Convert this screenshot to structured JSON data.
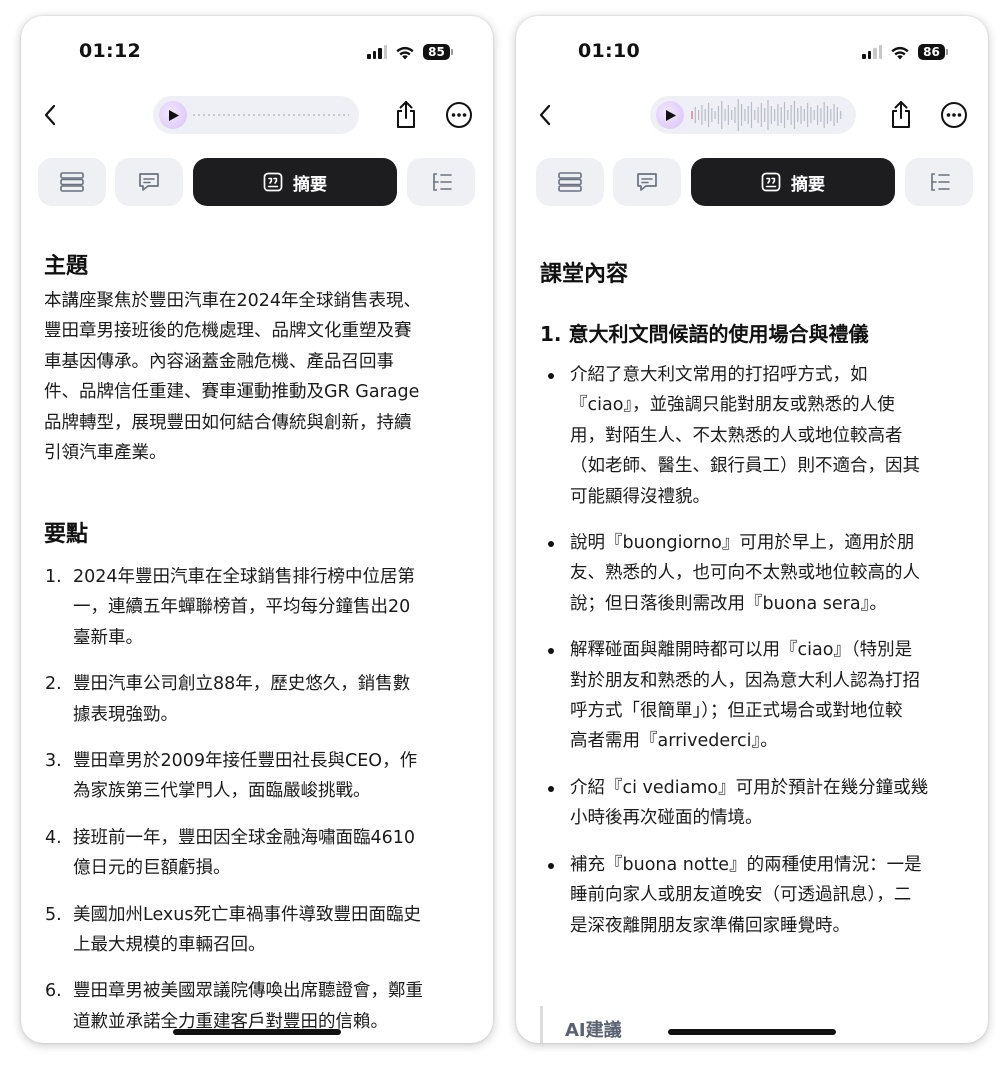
{
  "left": {
    "status": {
      "time": "01:12",
      "battery": "85"
    },
    "tabs": {
      "summary_label": "摘要"
    },
    "topic": {
      "heading": "主題",
      "lines": [
        "本講座聚焦於豐田汽車在2024年全球銷售表現、",
        "豐田章男接班後的危機處理、品牌文化重塑及賽",
        "車基因傳承。內容涵蓋金融危機、產品召回事",
        "件、品牌信任重建、賽車運動推動及GR Garage",
        "品牌轉型，展現豐田如何結合傳統與創新，持續",
        "引領汽車產業。"
      ]
    },
    "keypoints": {
      "heading": "要點",
      "items": [
        {
          "num": "1.",
          "lines": [
            "2024年豐田汽車在全球銷售排行榜中位居第",
            "一，連續五年蟬聯榜首，平均每分鐘售出20",
            "臺新車。"
          ]
        },
        {
          "num": "2.",
          "lines": [
            "豐田汽車公司創立88年，歷史悠久，銷售數",
            "據表現強勁。"
          ]
        },
        {
          "num": "3.",
          "lines": [
            "豐田章男於2009年接任豐田社長與CEO，作",
            "為家族第三代掌門人，面臨嚴峻挑戰。"
          ]
        },
        {
          "num": "4.",
          "lines": [
            "接班前一年，豐田因全球金融海嘯面臨4610",
            "億日元的巨額虧損。"
          ]
        },
        {
          "num": "5.",
          "lines": [
            "美國加州Lexus死亡車禍事件導致豐田面臨史",
            "上最大規模的車輛召回。"
          ]
        },
        {
          "num": "6.",
          "lines": [
            "豐田章男被美國眾議院傳喚出席聽證會，鄭重",
            "道歉並承諾全力重建客戶對豐田的信賴。"
          ]
        }
      ]
    }
  },
  "right": {
    "status": {
      "time": "01:10",
      "battery": "86"
    },
    "tabs": {
      "summary_label": "摘要"
    },
    "section_heading": "課堂內容",
    "sub_heading": "1. 意大利文問候語的使用場合與禮儀",
    "bullets": [
      {
        "lines": [
          "介紹了意大利文常用的打招呼方式，如",
          "『ciao』，並強調只能對朋友或熟悉的人使",
          "用，對陌生人、不太熟悉的人或地位較高者",
          "（如老師、醫生、銀行員工）則不適合，因其",
          "可能顯得沒禮貌。"
        ]
      },
      {
        "lines": [
          "說明『buongiorno』可用於早上，適用於朋",
          "友、熟悉的人，也可向不太熟或地位較高的人",
          "說；但日落後則需改用『buona sera』。"
        ]
      },
      {
        "lines": [
          "解釋碰面與離開時都可以用『ciao』（特別是",
          "對於朋友和熟悉的人，因為意大利人認為打招",
          "呼方式「很簡單」）；但正式場合或對地位較",
          "高者需用『arrivederci』。"
        ]
      },
      {
        "lines": [
          "介紹『ci vediamo』可用於預計在幾分鐘或幾",
          "小時後再次碰面的情境。"
        ]
      },
      {
        "lines": [
          "補充『buona notte』的兩種使用情況：一是",
          "睡前向家人或朋友道晚安（可透過訊息），二",
          "是深夜離開朋友家準備回家睡覺時。"
        ]
      }
    ],
    "ai_suggestion_title": "AI建議"
  }
}
